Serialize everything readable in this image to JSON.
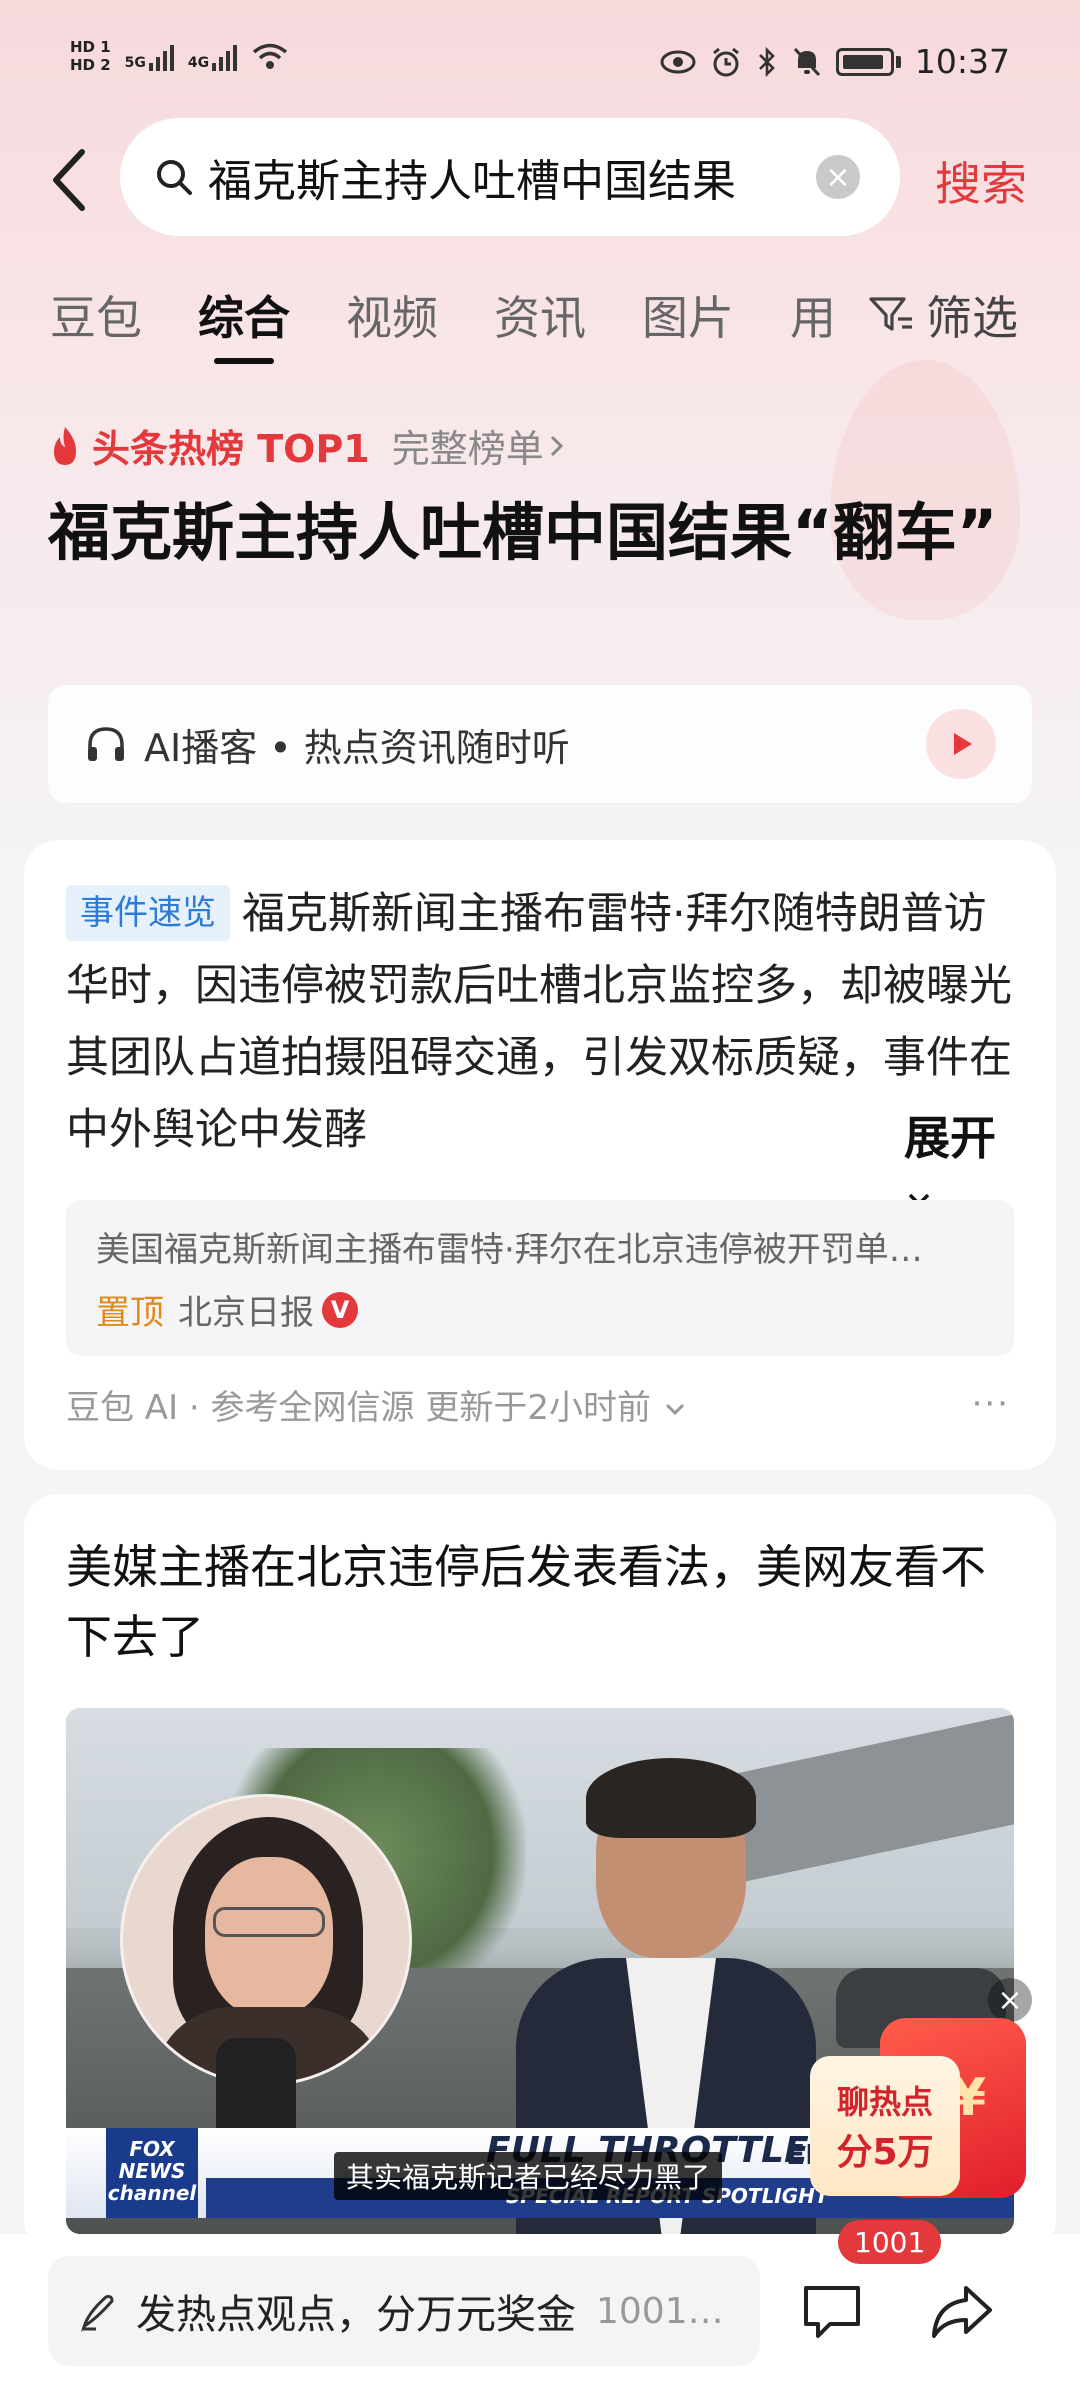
{
  "status_bar": {
    "hd1": "HD 1",
    "hd2": "HD 2",
    "sig1": "5G",
    "sig2": "4G",
    "time": "10:37"
  },
  "search": {
    "query": "福克斯主持人吐槽中国结果",
    "button_label": "搜索"
  },
  "tabs": [
    "豆包",
    "综合",
    "视频",
    "资讯",
    "图片",
    "用"
  ],
  "active_tab": "综合",
  "filter_label": "筛选",
  "hot_rank": {
    "label": "头条热榜 TOP1",
    "full_list": "完整榜单"
  },
  "headline": "福克斯主持人吐槽中国结果“翻车”",
  "ai_podcast": "AI播客 • 热点资讯随时听",
  "summary_card": {
    "tag": "事件速览",
    "text": "福克斯新闻主播布雷特·拜尔随特朗普访华时，因违停被罚款后吐槽北京监控多，却被曝光其团队占道拍摄阻碍交通，引发双标质疑，事件在中外舆论中发酵",
    "expand_label": "展开",
    "ref_title": "美国福克斯新闻主播布雷特·拜尔在北京违停被开罚单…",
    "ref_pin": "置顶",
    "ref_source": "北京日报",
    "ref_badge": "V",
    "footer": "豆包 AI · 参考全网信源 更新于2小时前",
    "more": "···"
  },
  "video_card": {
    "title": "美媒主播在北京违停后发表看法，美网友看不下去了",
    "fox_logo": "FOX NEWS channel",
    "banner_main": "FULL THROTTLE",
    "banner_sub": "SPECIAL REPORT SPOTLIGHT",
    "banner_side": "EETS",
    "subtitle": "其实福克斯记者已经尽力黑了"
  },
  "reward": {
    "line1": "聊热点",
    "line2": "分5万",
    "yen": "¥",
    "close": "×"
  },
  "bottom": {
    "comment_placeholder": "发热点观点，分万元奖金",
    "comment_count_inline": "1001…",
    "comment_badge": "1001"
  }
}
